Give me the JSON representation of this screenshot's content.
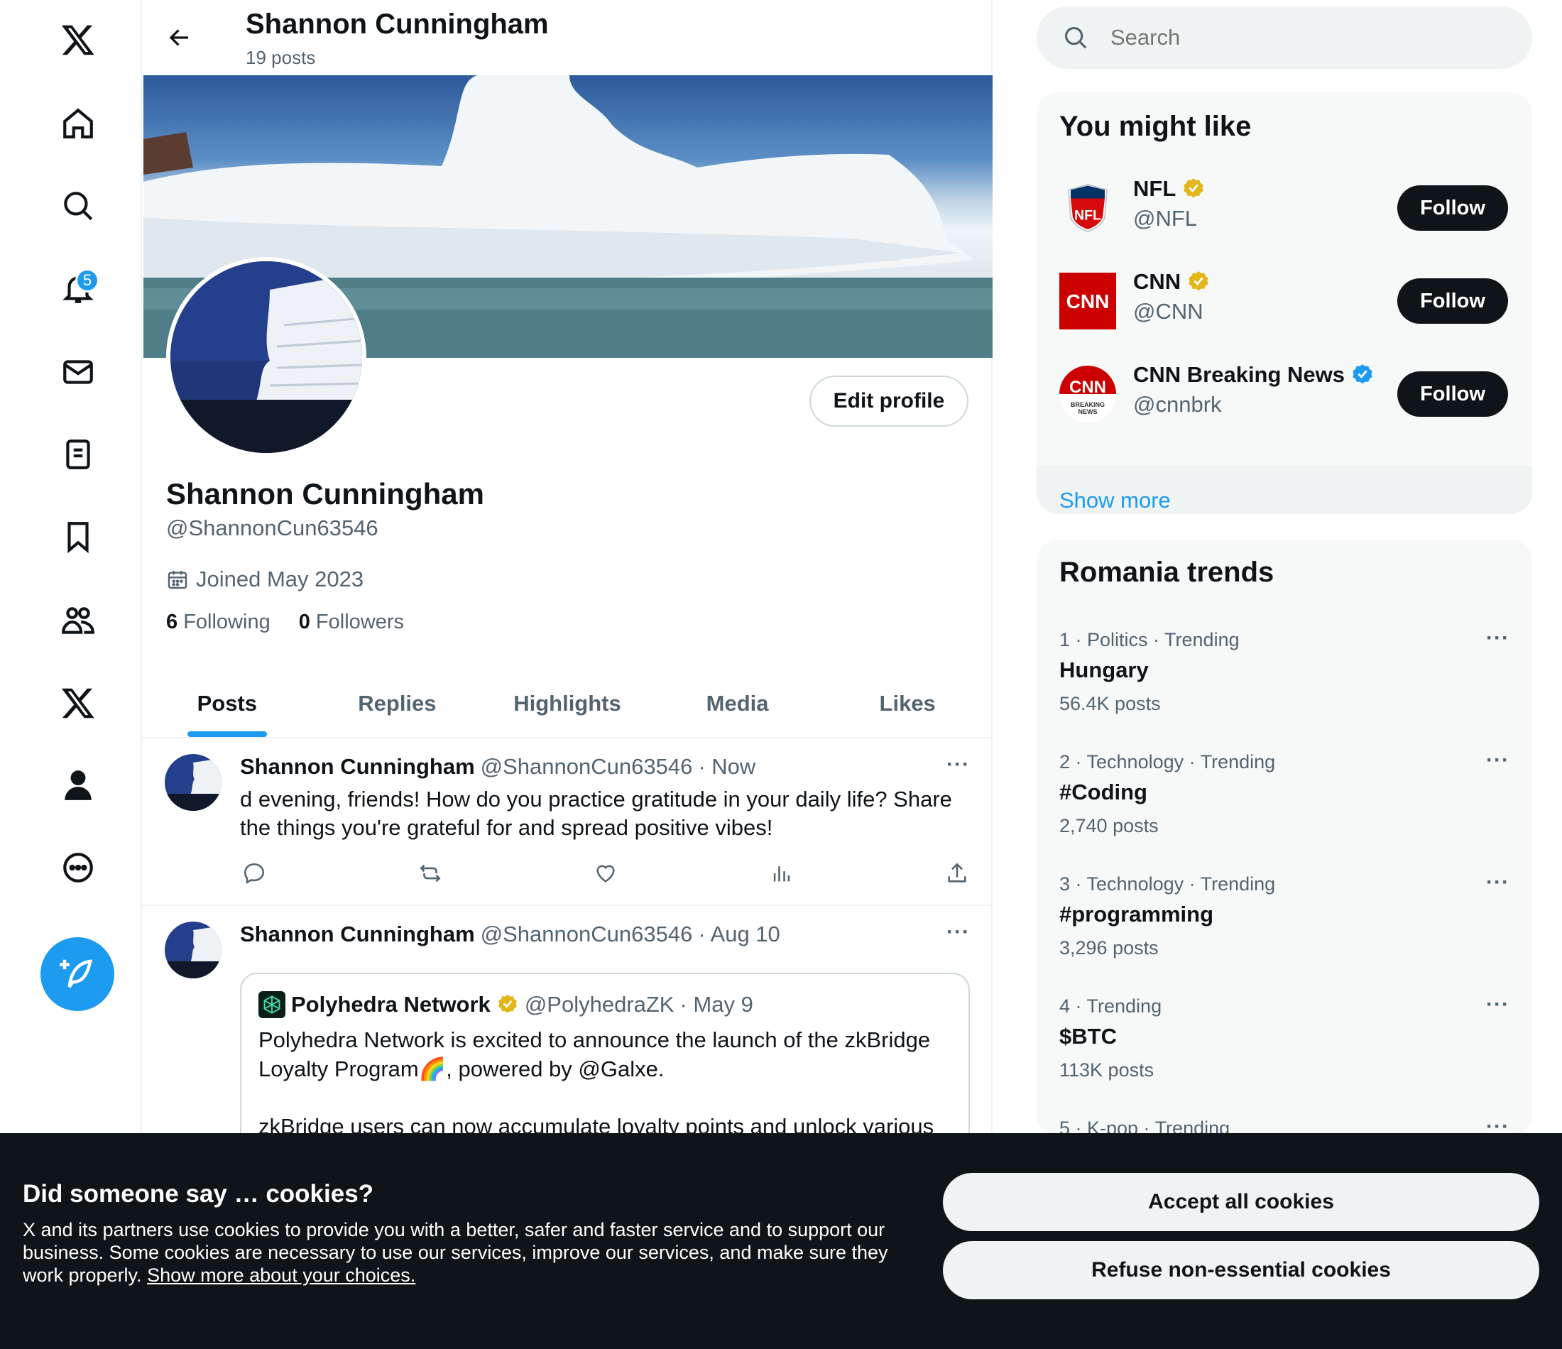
{
  "nav": {
    "notification_count": "5"
  },
  "header": {
    "name": "Shannon Cunningham",
    "post_count": "19 posts"
  },
  "profile": {
    "name": "Shannon Cunningham",
    "handle": "@ShannonCun63546",
    "joined": "Joined May 2023",
    "following_count": "6",
    "following_label": "Following",
    "followers_count": "0",
    "followers_label": "Followers",
    "edit_label": "Edit profile"
  },
  "tabs": [
    "Posts",
    "Replies",
    "Highlights",
    "Media",
    "Likes"
  ],
  "tweets": [
    {
      "name": "Shannon Cunningham",
      "handle": "@ShannonCun63546",
      "time": "· Now",
      "text": "d evening, friends! How do you practice gratitude in your daily life? Share the things you're grateful for and spread positive vibes!"
    },
    {
      "name": "Shannon Cunningham",
      "handle": "@ShannonCun63546",
      "time": "· Aug 10",
      "quote": {
        "name": "Polyhedra Network",
        "handle": "@PolyhedraZK",
        "time": "· May 9",
        "text1": "Polyhedra Network is excited to announce the launch of the zkBridge Loyalty Program🌈, powered by @Galxe.",
        "text2": "zkBridge users can now accumulate loyalty points and unlock various"
      }
    }
  ],
  "search": {
    "placeholder": "Search"
  },
  "who_to_follow": {
    "title": "You might like",
    "follow_label": "Follow",
    "accounts": [
      {
        "name": "NFL",
        "handle": "@NFL",
        "badge": "gold"
      },
      {
        "name": "CNN",
        "handle": "@CNN",
        "badge": "gold"
      },
      {
        "name": "CNN Breaking News",
        "handle": "@cnnbrk",
        "badge": "blue"
      }
    ],
    "show_more": "Show more"
  },
  "trends": {
    "title": "Romania trends",
    "items": [
      {
        "meta": "1 · Politics · Trending",
        "name": "Hungary",
        "count": "56.4K posts"
      },
      {
        "meta": "2 · Technology · Trending",
        "name": "#Coding",
        "count": "2,740 posts"
      },
      {
        "meta": "3 · Technology · Trending",
        "name": "#programming",
        "count": "3,296 posts"
      },
      {
        "meta": "4 · Trending",
        "name": "$BTC",
        "count": "113K posts"
      },
      {
        "meta": "5 · K-pop · Trending",
        "name": "",
        "count": ""
      }
    ]
  },
  "cookie": {
    "title": "Did someone say … cookies?",
    "text": "X and its partners use cookies to provide you with a better, safer and faster service and to support our business. Some cookies are necessary to use our services, improve our services, and make sure they work properly.",
    "link": "Show more about your choices.",
    "accept": "Accept all cookies",
    "refuse": "Refuse non-essential cookies"
  },
  "colors": {
    "accent": "#1d9bf0",
    "text": "#0f1419",
    "muted": "#536471",
    "gold": "#e2b719"
  }
}
